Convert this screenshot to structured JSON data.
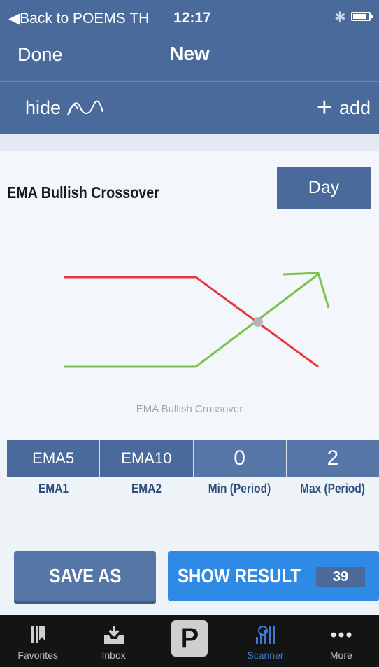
{
  "status_bar": {
    "back_label": "◀Back to POEMS TH",
    "time": "12:17"
  },
  "nav": {
    "done_label": "Done",
    "title": "New"
  },
  "toolbar": {
    "hide_label": "hide",
    "add_label": "add"
  },
  "strategy": {
    "title": "EMA Bullish Crossover",
    "period": "Day"
  },
  "diagram": {
    "caption": "EMA Bullish Crossover",
    "line1_color": "#e8383d",
    "line2_color": "#7cc24a",
    "cross_color": "#b4b4b4"
  },
  "params": {
    "values": [
      "EMA5",
      "EMA10",
      "0",
      "2"
    ],
    "labels": [
      "EMA1",
      "EMA2",
      "Min (Period)",
      "Max (Period)"
    ]
  },
  "actions": {
    "save_as_label": "SAVE AS",
    "show_result_label": "SHOW RESULT",
    "result_count": "39"
  },
  "tabbar": {
    "items": [
      {
        "label": "Favorites",
        "icon": "favorites-icon"
      },
      {
        "label": "Inbox",
        "icon": "inbox-icon"
      },
      {
        "label": "",
        "icon": "poems-logo-icon",
        "logo_text": "P"
      },
      {
        "label": "Scanner",
        "icon": "scanner-icon",
        "active": true
      },
      {
        "label": "More",
        "icon": "more-icon"
      }
    ]
  },
  "colors": {
    "header": "#4a6a9b",
    "primary_button": "#2f8ae6",
    "tab_active": "#3e7bd6"
  }
}
